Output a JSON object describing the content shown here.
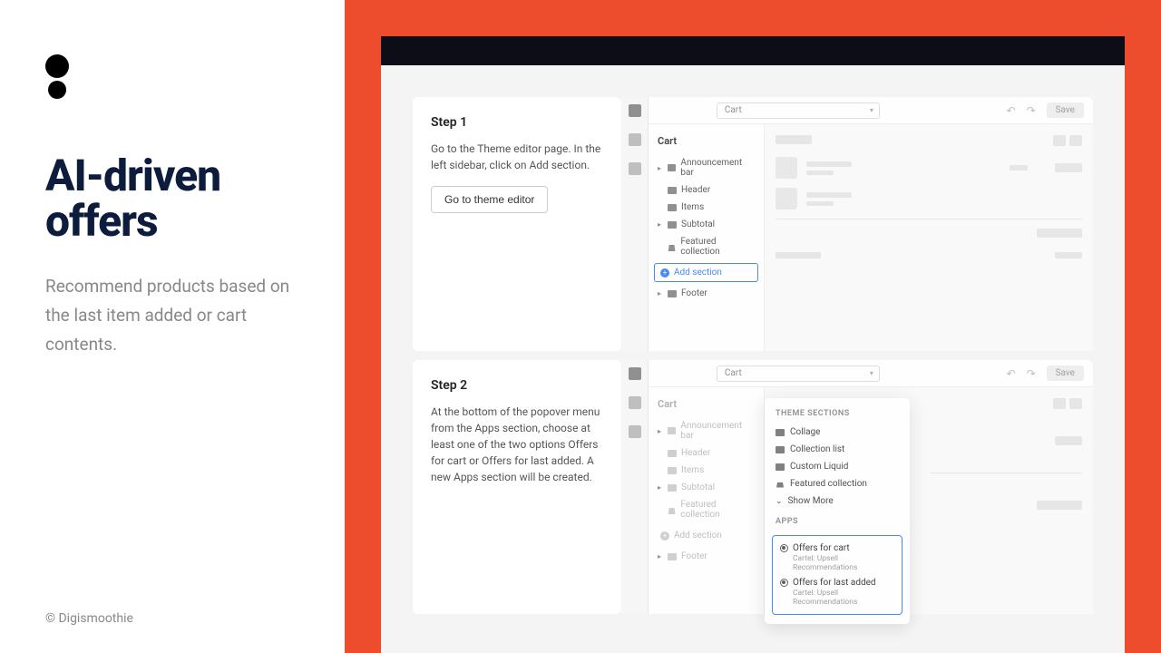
{
  "left": {
    "title": "AI-driven offers",
    "subtitle": "Recommend products based on the last item added or cart contents.",
    "copyright": "© Digismoothie"
  },
  "steps": [
    {
      "title": "Step 1",
      "desc": "Go to the Theme editor page. In the left sidebar, click on Add section.",
      "button": "Go to theme editor"
    },
    {
      "title": "Step 2",
      "desc": "At the bottom of the popover menu from the Apps section, choose at least one of the two options Offers for cart or Offers for last added. A new Apps section will be created."
    }
  ],
  "editor": {
    "page_select": "Cart",
    "save": "Save",
    "sidebar_title": "Cart",
    "sections": {
      "announcement": "Announcement bar",
      "header": "Header",
      "items": "Items",
      "subtotal": "Subtotal",
      "featured": "Featured collection",
      "add": "Add section",
      "footer": "Footer"
    }
  },
  "popover": {
    "theme_heading": "THEME SECTIONS",
    "collage": "Collage",
    "collection_list": "Collection list",
    "custom_liquid": "Custom Liquid",
    "featured": "Featured collection",
    "show_more": "Show More",
    "apps_heading": "APPS",
    "offer_cart": "Offers for cart",
    "offer_last": "Offers for last added",
    "app_sub": "Cartel: Upsell Recommendations"
  }
}
